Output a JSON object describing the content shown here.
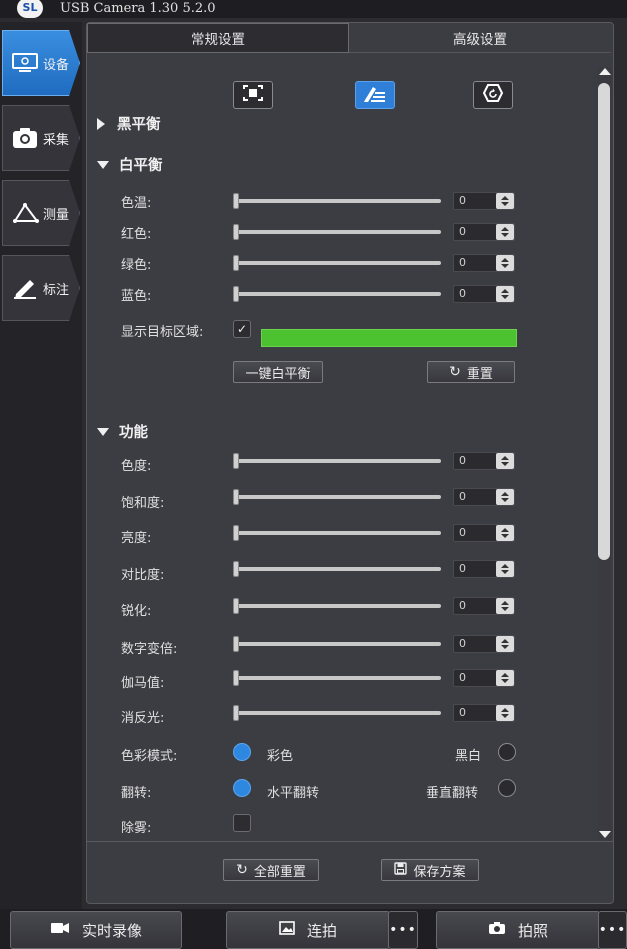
{
  "window": {
    "logo": "SL",
    "title": "USB Camera   1.30 5.2.0"
  },
  "nav": [
    {
      "label": "设备",
      "icon": "monitor-icon",
      "active": true
    },
    {
      "label": "采集",
      "icon": "camera-icon",
      "active": false
    },
    {
      "label": "测量",
      "icon": "measure-angle-icon",
      "active": false
    },
    {
      "label": "标注",
      "icon": "pencil-icon",
      "active": false
    }
  ],
  "tabs": {
    "normal": "常规设置",
    "advanced": "高级设置"
  },
  "black_balance": {
    "title": "黑平衡",
    "icons": [
      "frame-select-icon",
      "manual-edit-icon",
      "reset-circle-icon"
    ]
  },
  "white_balance": {
    "title": "白平衡",
    "rows": [
      {
        "label": "色温:",
        "value": "0"
      },
      {
        "label": "红色:",
        "value": "0"
      },
      {
        "label": "绿色:",
        "value": "0"
      },
      {
        "label": "蓝色:",
        "value": "0"
      }
    ],
    "show_area_label": "显示目标区域:",
    "show_area_checked": "✓",
    "auto_button": "一键白平衡",
    "reset_button": "重置"
  },
  "functions": {
    "title": "功能",
    "rows": [
      {
        "label": "色度:",
        "value": "0"
      },
      {
        "label": "饱和度:",
        "value": "0"
      },
      {
        "label": "亮度:",
        "value": "0"
      },
      {
        "label": "对比度:",
        "value": "0"
      },
      {
        "label": "锐化:",
        "value": "0"
      },
      {
        "label": "数字变倍:",
        "value": "0"
      },
      {
        "label": "伽马值:",
        "value": "0"
      },
      {
        "label": "消反光:",
        "value": "0"
      }
    ],
    "color_mode": {
      "label": "色彩模式:",
      "option_a": "彩色",
      "option_b": "黑白"
    },
    "flip": {
      "label": "翻转:",
      "option_a": "水平翻转",
      "option_b": "垂直翻转"
    },
    "defog": {
      "label": "除雾:"
    }
  },
  "footer": {
    "reset_all": "全部重置",
    "save_scheme": "保存方案"
  },
  "bottom": {
    "record": "实时录像",
    "burst": "连拍",
    "photo": "拍照",
    "more": "•••"
  },
  "colors": {
    "accent": "#2f7fd8",
    "target_area": "#4dc231"
  }
}
